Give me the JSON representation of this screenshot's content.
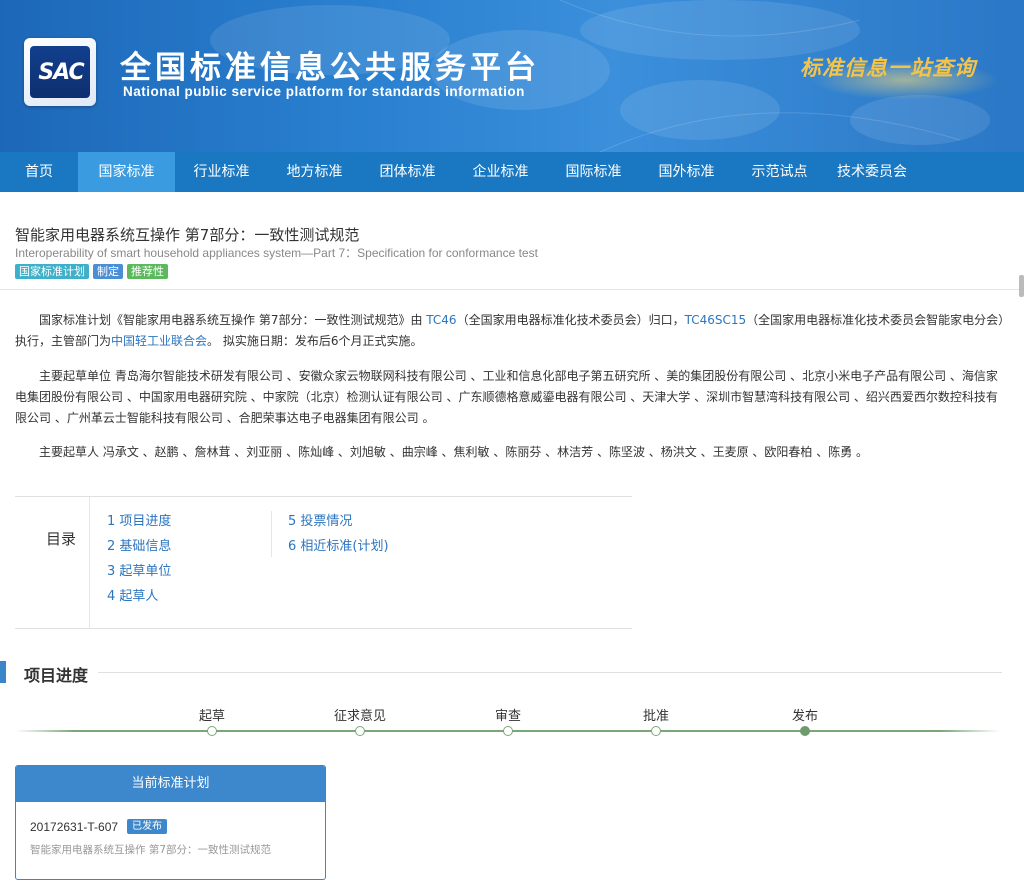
{
  "header": {
    "logo_text": "SAC",
    "title_cn": "全国标准信息公共服务平台",
    "title_en": "National public service platform  for standards information",
    "slogan": "标准信息一站查询"
  },
  "nav": {
    "items": [
      "首页",
      "国家标准",
      "行业标准",
      "地方标准",
      "团体标准",
      "企业标准",
      "国际标准",
      "国外标准",
      "示范试点",
      "技术委员会"
    ],
    "active": "国家标准"
  },
  "standard": {
    "title_cn": "智能家用电器系统互操作 第7部分：一致性测试规范",
    "title_en": "Interoperability of smart household appliances system—Part 7：Specification for conformance test",
    "tags": [
      {
        "label": "国家标准计划",
        "color": "#3fb0c9"
      },
      {
        "label": "制定",
        "color": "#4a8fd6"
      },
      {
        "label": "推荐性",
        "color": "#5cb85c"
      }
    ]
  },
  "intro": {
    "p1_a": "国家标准计划《智能家用电器系统互操作 第7部分：一致性测试规范》由 ",
    "tc_link": "TC46",
    "p1_b": "（全国家用电器标准化技术委员会）归口，",
    "sc_link": "TC46SC15",
    "p1_c": "（全国家用电器标准化技术委员会智能家电分会）执行，主管部门为",
    "dept_link": "中国轻工业联合会",
    "p1_d": "。 拟实施日期：发布后6个月正式实施。",
    "p2": "主要起草单位 青岛海尔智能技术研发有限公司 、安徽众家云物联网科技有限公司 、工业和信息化部电子第五研究所 、美的集团股份有限公司 、北京小米电子产品有限公司 、海信家电集团股份有限公司 、中国家用电器研究院 、中家院（北京）检测认证有限公司 、广东顺德格意威鎏电器有限公司 、天津大学 、深圳市智慧湾科技有限公司 、绍兴西爱西尔数控科技有限公司 、广州革云士智能科技有限公司 、合肥荣事达电子电器集团有限公司 。",
    "p3": "主要起草人 冯承文 、赵鹏 、詹林茸 、刘亚丽 、陈灿峰 、刘旭敏 、曲宗峰 、焦利敏 、陈丽芬 、林洁芳 、陈坚波 、杨洪文 、王麦原 、欧阳春柏 、陈勇 。"
  },
  "toc": {
    "label": "目录",
    "col1": [
      "1  项目进度",
      "2  基础信息",
      "3  起草单位",
      "4  起草人"
    ],
    "col2": [
      "5  投票情况",
      "6  相近标准(计划)"
    ]
  },
  "progress": {
    "section_title": "项目进度",
    "steps": [
      {
        "label": "起草",
        "done": false
      },
      {
        "label": "征求意见",
        "done": false
      },
      {
        "label": "审查",
        "done": false
      },
      {
        "label": "批准",
        "done": false
      },
      {
        "label": "发布",
        "done": true
      }
    ]
  },
  "current_plan": {
    "header": "当前标准计划",
    "code": "20172631-T-607",
    "status": "已发布",
    "name": "智能家用电器系统互操作 第7部分：一致性测试规范"
  }
}
